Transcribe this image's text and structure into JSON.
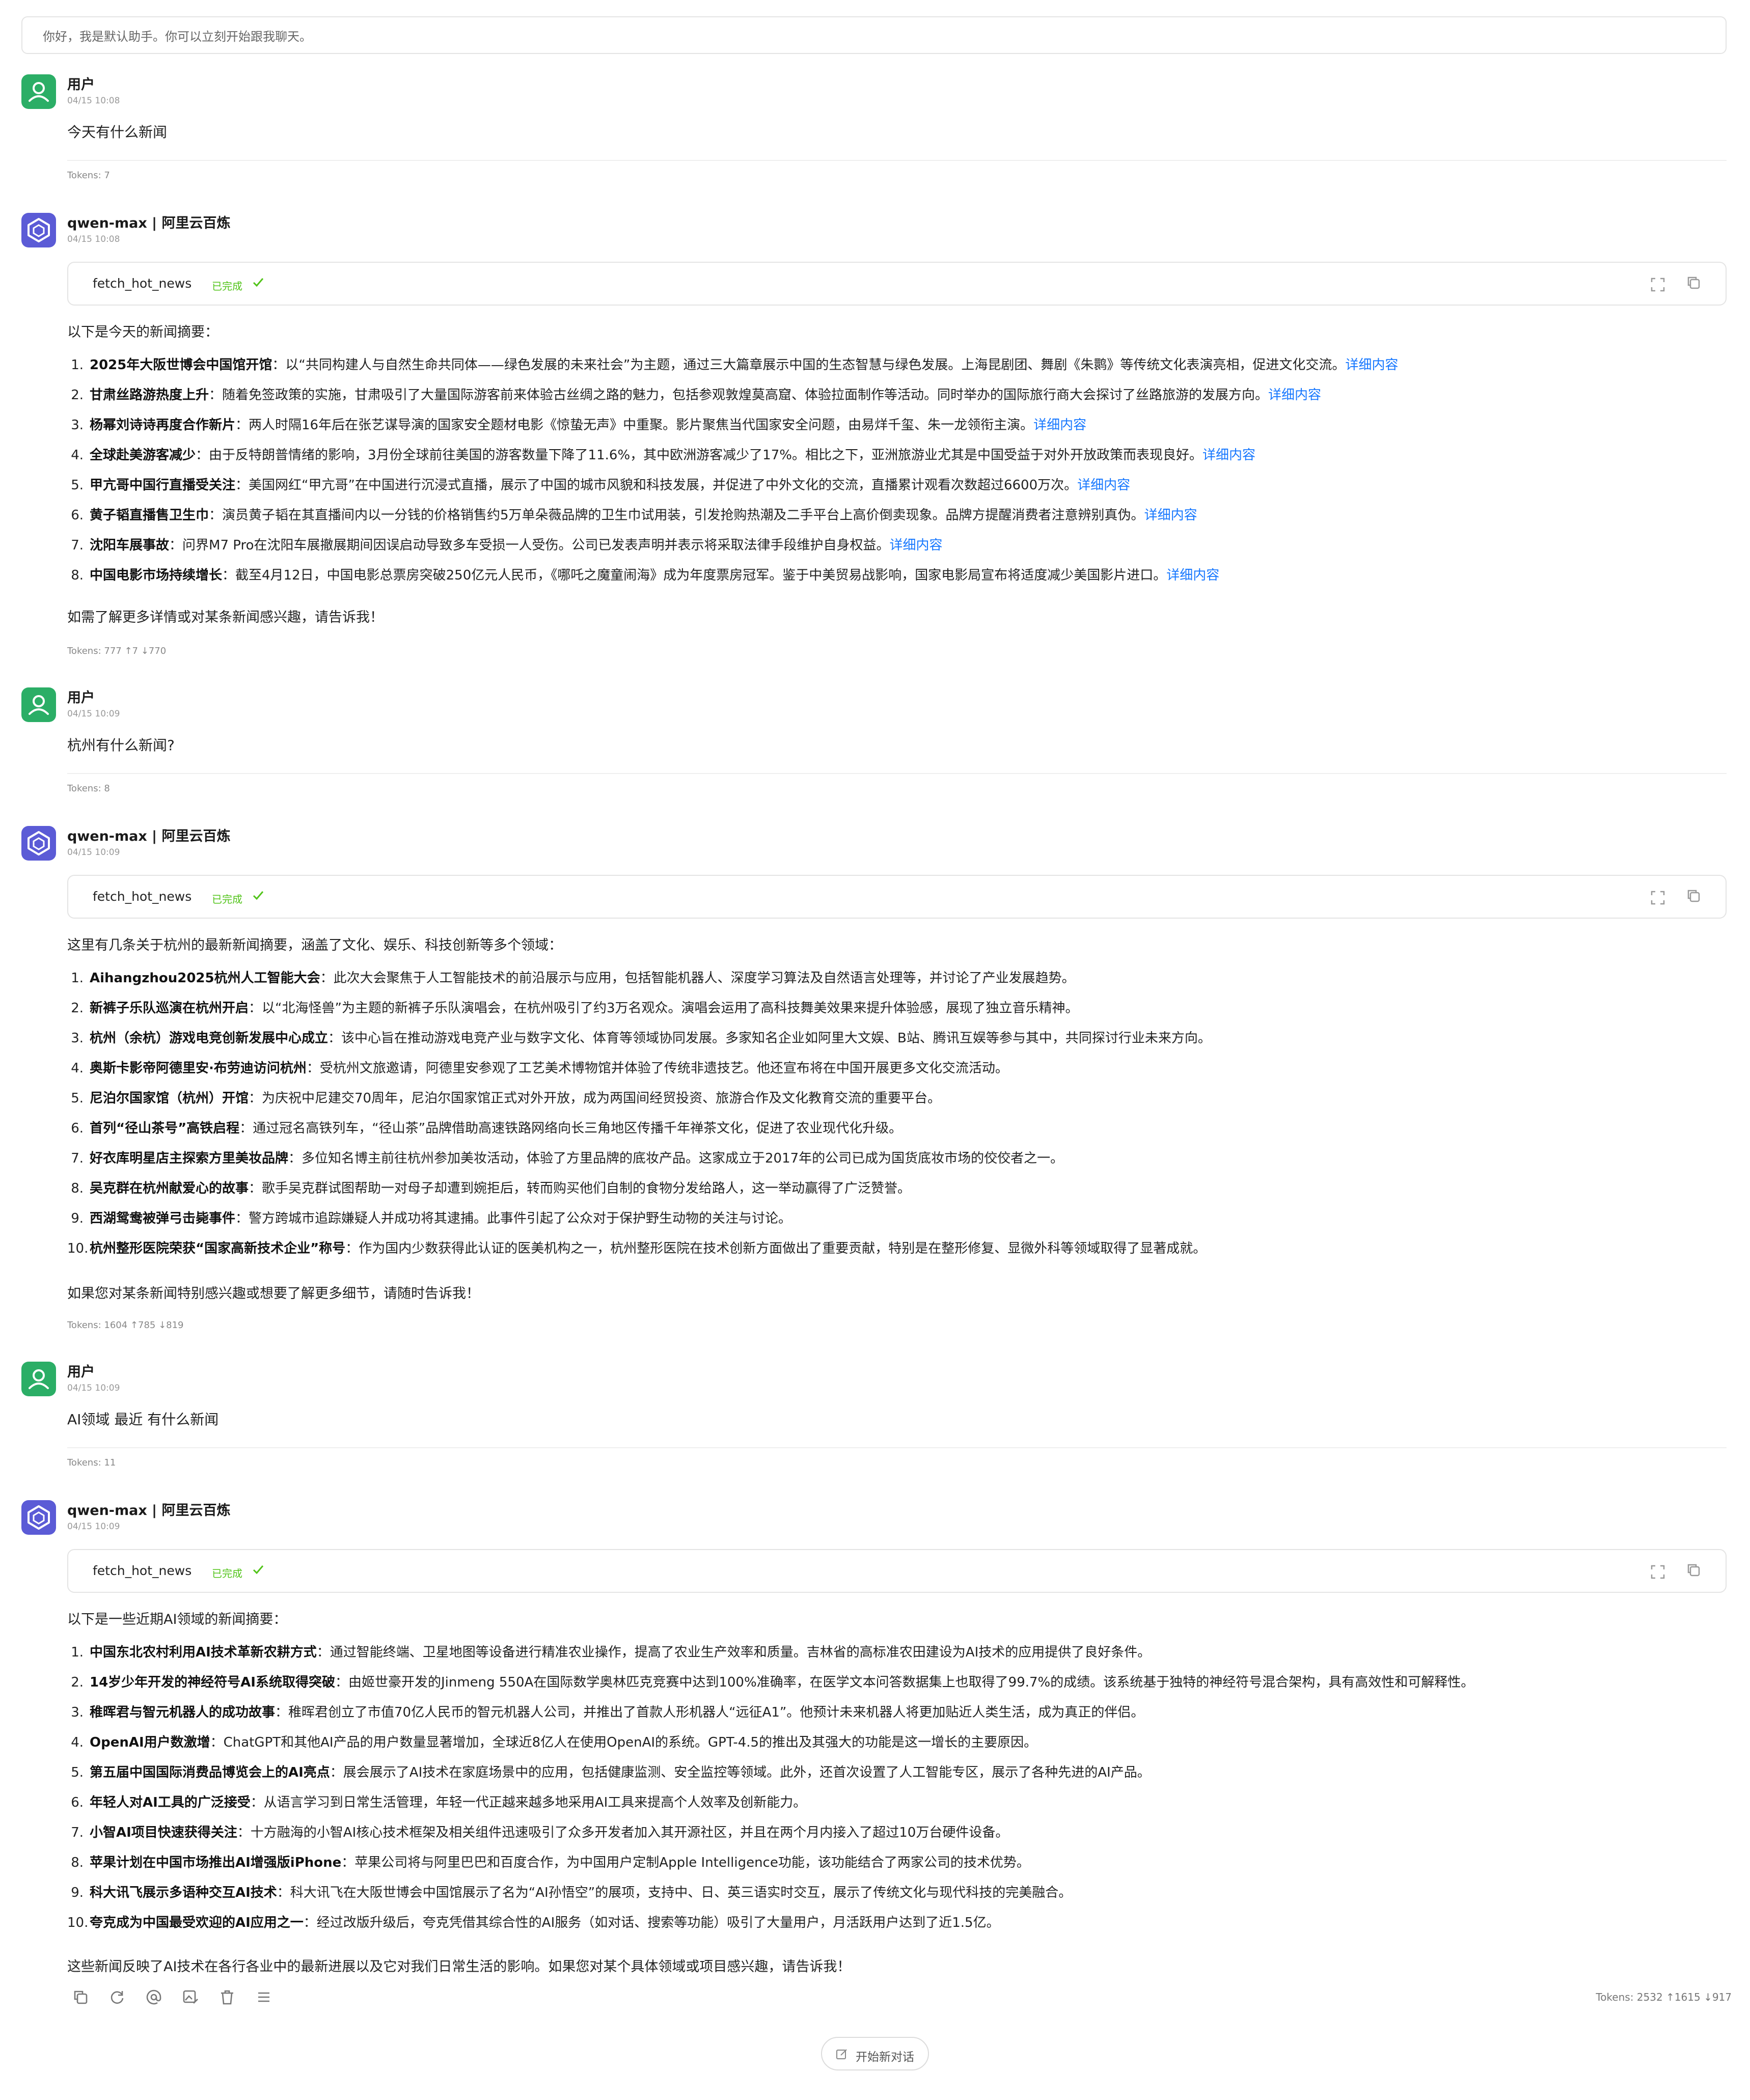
{
  "notice": "你好，我是默认助手。你可以立刻开始跟我聊天。",
  "messages": {
    "u1": {
      "name": "用户",
      "time": "04/15 10:08",
      "text": "今天有什么新闻",
      "tokens": "Tokens: 7"
    },
    "a1": {
      "name": "qwen-max | 阿里云百炼",
      "time": "04/15 10:08",
      "tool": {
        "name": "fetch_hot_news",
        "status": "已完成"
      },
      "intro": "以下是今天的新闻摘要：",
      "items": [
        {
          "num": "1.",
          "title": "2025年大阪世博会中国馆开馆",
          "text": "：以“共同构建人与自然生命共同体——绿色发展的未来社会”为主题，通过三大篇章展示中国的生态智慧与绿色发展。上海昆剧团、舞剧《朱鹮》等传统文化表演亮相，促进文化交流。",
          "link": "详细内容"
        },
        {
          "num": "2.",
          "title": "甘肃丝路游热度上升",
          "text": "：随着免签政策的实施，甘肃吸引了大量国际游客前来体验古丝绸之路的魅力，包括参观敦煌莫高窟、体验拉面制作等活动。同时举办的国际旅行商大会探讨了丝路旅游的发展方向。",
          "link": "详细内容"
        },
        {
          "num": "3.",
          "title": "杨幂刘诗诗再度合作新片",
          "text": "：两人时隔16年后在张艺谋导演的国家安全题材电影《惊蛰无声》中重聚。影片聚焦当代国家安全问题，由易烊千玺、朱一龙领衔主演。",
          "link": "详细内容"
        },
        {
          "num": "4.",
          "title": "全球赴美游客减少",
          "text": "：由于反特朗普情绪的影响，3月份全球前往美国的游客数量下降了11.6%，其中欧洲游客减少了17%。相比之下，亚洲旅游业尤其是中国受益于对外开放政策而表现良好。",
          "link": "详细内容"
        },
        {
          "num": "5.",
          "title": "甲亢哥中国行直播受关注",
          "text": "：美国网红“甲亢哥”在中国进行沉浸式直播，展示了中国的城市风貌和科技发展，并促进了中外文化的交流，直播累计观看次数超过6600万次。",
          "link": "详细内容"
        },
        {
          "num": "6.",
          "title": "黄子韬直播售卫生巾",
          "text": "：演员黄子韬在其直播间内以一分钱的价格销售约5万单朵薇品牌的卫生巾试用装，引发抢购热潮及二手平台上高价倒卖现象。品牌方提醒消费者注意辨别真伪。",
          "link": "详细内容"
        },
        {
          "num": "7.",
          "title": "沈阳车展事故",
          "text": "：问界M7 Pro在沈阳车展撤展期间因误启动导致多车受损一人受伤。公司已发表声明并表示将采取法律手段维护自身权益。",
          "link": "详细内容"
        },
        {
          "num": "8.",
          "title": "中国电影市场持续增长",
          "text": "：截至4月12日，中国电影总票房突破250亿元人民币，《哪吒之魔童闹海》成为年度票房冠军。鉴于中美贸易战影响，国家电影局宣布将适度减少美国影片进口。",
          "link": "详细内容"
        }
      ],
      "outro": "如需了解更多详情或对某条新闻感兴趣，请告诉我！",
      "tokens": "Tokens: 777 ↑7 ↓770"
    },
    "u2": {
      "name": "用户",
      "time": "04/15 10:09",
      "text": "杭州有什么新闻?",
      "tokens": "Tokens: 8"
    },
    "a2": {
      "name": "qwen-max | 阿里云百炼",
      "time": "04/15 10:09",
      "tool": {
        "name": "fetch_hot_news",
        "status": "已完成"
      },
      "intro": "这里有几条关于杭州的最新新闻摘要，涵盖了文化、娱乐、科技创新等多个领域：",
      "items": [
        {
          "num": "1.",
          "title": "Aihangzhou2025杭州人工智能大会",
          "text": "：此次大会聚焦于人工智能技术的前沿展示与应用，包括智能机器人、深度学习算法及自然语言处理等，并讨论了产业发展趋势。"
        },
        {
          "num": "2.",
          "title": "新裤子乐队巡演在杭州开启",
          "text": "：以“北海怪兽”为主题的新裤子乐队演唱会，在杭州吸引了约3万名观众。演唱会运用了高科技舞美效果来提升体验感，展现了独立音乐精神。"
        },
        {
          "num": "3.",
          "title": "杭州（余杭）游戏电竞创新发展中心成立",
          "text": "：该中心旨在推动游戏电竞产业与数字文化、体育等领域协同发展。多家知名企业如阿里大文娱、B站、腾讯互娱等参与其中，共同探讨行业未来方向。"
        },
        {
          "num": "4.",
          "title": "奥斯卡影帝阿德里安·布劳迪访问杭州",
          "text": "：受杭州文旅邀请，阿德里安参观了工艺美术博物馆并体验了传统非遗技艺。他还宣布将在中国开展更多文化交流活动。"
        },
        {
          "num": "5.",
          "title": "尼泊尔国家馆（杭州）开馆",
          "text": "：为庆祝中尼建交70周年，尼泊尔国家馆正式对外开放，成为两国间经贸投资、旅游合作及文化教育交流的重要平台。"
        },
        {
          "num": "6.",
          "title": "首列“径山茶号”高铁启程",
          "text": "：通过冠名高铁列车，“径山茶”品牌借助高速铁路网络向长三角地区传播千年禅茶文化，促进了农业现代化升级。"
        },
        {
          "num": "7.",
          "title": "好衣库明星店主探索方里美妆品牌",
          "text": "：多位知名博主前往杭州参加美妆活动，体验了方里品牌的底妆产品。这家成立于2017年的公司已成为国货底妆市场的佼佼者之一。"
        },
        {
          "num": "8.",
          "title": "吴克群在杭州献爱心的故事",
          "text": "：歌手吴克群试图帮助一对母子却遭到婉拒后，转而购买他们自制的食物分发给路人，这一举动赢得了广泛赞誉。"
        },
        {
          "num": "9.",
          "title": "西湖鸳鸯被弹弓击毙事件",
          "text": "：警方跨城市追踪嫌疑人并成功将其逮捕。此事件引起了公众对于保护野生动物的关注与讨论。"
        },
        {
          "num": "10.",
          "title": "杭州整形医院荣获“国家高新技术企业”称号",
          "text": "：作为国内少数获得此认证的医美机构之一，杭州整形医院在技术创新方面做出了重要贡献，特别是在整形修复、显微外科等领域取得了显著成就。"
        }
      ],
      "outro": "如果您对某条新闻特别感兴趣或想要了解更多细节，请随时告诉我！",
      "tokens": "Tokens: 1604 ↑785 ↓819"
    },
    "u3": {
      "name": "用户",
      "time": "04/15 10:09",
      "text": "AI领域 最近 有什么新闻",
      "tokens": "Tokens: 11"
    },
    "a3": {
      "name": "qwen-max | 阿里云百炼",
      "time": "04/15 10:09",
      "tool": {
        "name": "fetch_hot_news",
        "status": "已完成"
      },
      "intro": "以下是一些近期AI领域的新闻摘要：",
      "items": [
        {
          "num": "1.",
          "title": "中国东北农村利用AI技术革新农耕方式",
          "text": "：通过智能终端、卫星地图等设备进行精准农业操作，提高了农业生产效率和质量。吉林省的高标准农田建设为AI技术的应用提供了良好条件。"
        },
        {
          "num": "2.",
          "title": "14岁少年开发的神经符号AI系统取得突破",
          "text": "：由姬世豪开发的Jinmeng 550A在国际数学奥林匹克竞赛中达到100%准确率，在医学文本问答数据集上也取得了99.7%的成绩。该系统基于独特的神经符号混合架构，具有高效性和可解释性。"
        },
        {
          "num": "3.",
          "title": "稚晖君与智元机器人的成功故事",
          "text": "：稚晖君创立了市值70亿人民币的智元机器人公司，并推出了首款人形机器人“远征A1”。他预计未来机器人将更加贴近人类生活，成为真正的伴侣。"
        },
        {
          "num": "4.",
          "title": "OpenAI用户数激增",
          "text": "：ChatGPT和其他AI产品的用户数量显著增加，全球近8亿人在使用OpenAI的系统。GPT-4.5的推出及其强大的功能是这一增长的主要原因。"
        },
        {
          "num": "5.",
          "title": "第五届中国国际消费品博览会上的AI亮点",
          "text": "：展会展示了AI技术在家庭场景中的应用，包括健康监测、安全监控等领域。此外，还首次设置了人工智能专区，展示了各种先进的AI产品。"
        },
        {
          "num": "6.",
          "title": "年轻人对AI工具的广泛接受",
          "text": "：从语言学习到日常生活管理，年轻一代正越来越多地采用AI工具来提高个人效率及创新能力。"
        },
        {
          "num": "7.",
          "title": "小智AI项目快速获得关注",
          "text": "：十方融海的小智AI核心技术框架及相关组件迅速吸引了众多开发者加入其开源社区，并且在两个月内接入了超过10万台硬件设备。"
        },
        {
          "num": "8.",
          "title": "苹果计划在中国市场推出AI增强版iPhone",
          "text": "：苹果公司将与阿里巴巴和百度合作，为中国用户定制Apple Intelligence功能，该功能结合了两家公司的技术优势。"
        },
        {
          "num": "9.",
          "title": "科大讯飞展示多语种交互AI技术",
          "text": "：科大讯飞在大阪世博会中国馆展示了名为“AI孙悟空”的展项，支持中、日、英三语实时交互，展示了传统文化与现代科技的完美融合。"
        },
        {
          "num": "10.",
          "title": "夸克成为中国最受欢迎的AI应用之一",
          "text": "：经过改版升级后，夸克凭借其综合性的AI服务（如对话、搜索等功能）吸引了大量用户，月活跃用户达到了近1.5亿。"
        }
      ],
      "outro": "这些新闻反映了AI技术在各行各业中的最新进展以及它对我们日常生活的影响。如果您对某个具体领域或项目感兴趣，请告诉我！",
      "tokens": "Tokens: 2532 ↑1615 ↓917"
    }
  },
  "actions": [
    "copy-icon",
    "refresh-icon",
    "at-icon",
    "image-edit-icon",
    "trash-icon",
    "menu-icon"
  ],
  "new_chat": "开始新对话",
  "colors": {
    "user_avatar": "#2bae66",
    "ai_avatar": "#5b5bd6",
    "link": "#1677ff",
    "done": "#52c41a"
  }
}
